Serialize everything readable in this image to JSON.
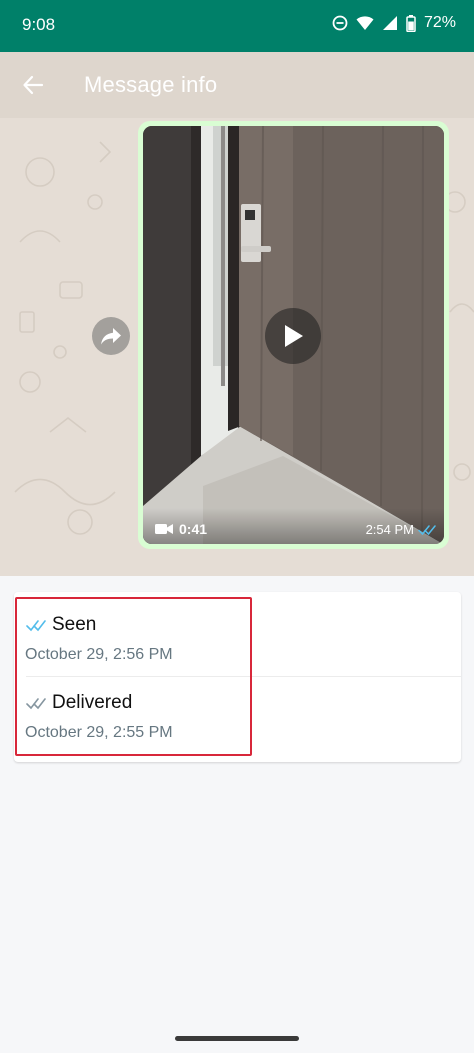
{
  "status_bar": {
    "time": "9:08",
    "battery": "72%",
    "icons": [
      "do-not-disturb-icon",
      "wifi-icon",
      "signal-icon",
      "battery-icon"
    ]
  },
  "header": {
    "title": "Message info",
    "back_icon": "arrow-left-icon"
  },
  "message": {
    "type": "video",
    "duration": "0:41",
    "time": "2:54 PM",
    "tick_status": "read",
    "forward_icon": "forward-icon",
    "play_icon": "play-icon",
    "bubble_color": "#d9fdd3"
  },
  "receipts": [
    {
      "label": "Seen",
      "date": "October 29, 2:56 PM",
      "tick_color": "#53bdeb"
    },
    {
      "label": "Delivered",
      "date": "October 29, 2:55 PM",
      "tick_color": "#8696a0"
    }
  ],
  "colors": {
    "accent": "#008069",
    "highlight": "#d8273a",
    "wallpaper": "#e5ddd5"
  }
}
